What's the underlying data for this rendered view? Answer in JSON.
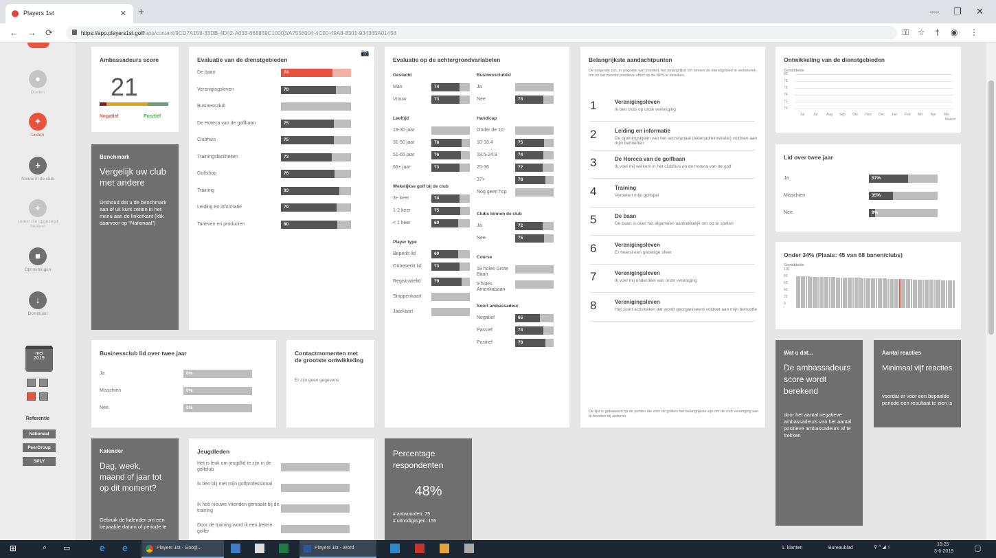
{
  "browser": {
    "tab_title": "Players 1st",
    "url_host": "https://app.players1st.golf",
    "url_path": "/app/content/9CD7A158-33DB-4D42-A033-668859C10003/A7556004-4C00-49A8-8301-934365A01458"
  },
  "sidebar": {
    "items": [
      {
        "label": "Doelen",
        "icon": "user-icon"
      },
      {
        "label": "Leden",
        "icon": "users-icon"
      },
      {
        "label": "Nieuw in de club",
        "icon": "plus-icon"
      },
      {
        "label": "Leden die opgezegd hebben",
        "icon": "minus-icon"
      },
      {
        "label": "Opmerkingen",
        "icon": "comment-icon"
      },
      {
        "label": "Download",
        "icon": "download-icon"
      }
    ],
    "calendar": {
      "month": "mei",
      "year": "2019"
    },
    "reference_title": "Referentie",
    "reference": [
      "Nationaal",
      "PeerGroup",
      "SPLY"
    ]
  },
  "score": {
    "title": "Ambassadeurs score",
    "value": "21",
    "neg": "Negatief",
    "pos": "Positief"
  },
  "benchmark": {
    "head": "Benchmark",
    "title": "Vergelijk uw club met andere",
    "body": "Onthoud dat u de benchmark aan of uit kunt zetten in het menu aan de linkerkant (klik daarvoor op \"Nationaal\")"
  },
  "diensten": {
    "title": "Evaluatie van de dienstgebieden",
    "items": [
      {
        "label": "De baan",
        "value": "74",
        "pct": 0.74,
        "hl": true
      },
      {
        "label": "Verenigingsleven",
        "value": "78",
        "pct": 0.78
      },
      {
        "label": "Businessclub",
        "value": "",
        "pct": 0
      },
      {
        "label": "De Horeca van de golfbaan",
        "value": "75",
        "pct": 0.75
      },
      {
        "label": "Clubhuis",
        "value": "75",
        "pct": 0.75
      },
      {
        "label": "Trainingsfaciliteiten",
        "value": "73",
        "pct": 0.73
      },
      {
        "label": "Golfshop",
        "value": "76",
        "pct": 0.76
      },
      {
        "label": "Training",
        "value": "83",
        "pct": 0.83
      },
      {
        "label": "Leiding en informatie",
        "value": "79",
        "pct": 0.79
      },
      {
        "label": "Tarieven en producten",
        "value": "80",
        "pct": 0.8
      }
    ]
  },
  "achtergrond": {
    "title": "Evaluatie op de achtergrondvariabelen",
    "left": [
      {
        "sub": "Geslacht",
        "rows": [
          {
            "l": "Man",
            "v": "74",
            "p": 0.74
          },
          {
            "l": "Vrouw",
            "v": "73",
            "p": 0.73
          }
        ]
      },
      {
        "sub": "Leeftijd",
        "rows": [
          {
            "l": "19-30 jaar",
            "v": "",
            "p": 0
          },
          {
            "l": "31-50 jaar",
            "v": "78",
            "p": 0.78
          },
          {
            "l": "51-65 jaar",
            "v": "76",
            "p": 0.76
          },
          {
            "l": "66+ jaar",
            "v": "73",
            "p": 0.73
          }
        ]
      },
      {
        "sub": "Wekelijkse golf bij de club",
        "rows": [
          {
            "l": "3+ keer",
            "v": "74",
            "p": 0.74
          },
          {
            "l": "1-2 keer",
            "v": "75",
            "p": 0.75
          },
          {
            "l": "< 1 keer",
            "v": "69",
            "p": 0.69
          }
        ]
      },
      {
        "sub": "Player type",
        "rows": [
          {
            "l": "Beperkt lid",
            "v": "69",
            "p": 0.69
          },
          {
            "l": "Onbeperkt lid",
            "v": "73",
            "p": 0.73
          },
          {
            "l": "Registratielid",
            "v": "79",
            "p": 0.79
          },
          {
            "l": "Strippenkaart",
            "v": "",
            "p": 0
          },
          {
            "l": "Jaarkaart",
            "v": "",
            "p": 0
          }
        ]
      }
    ],
    "right": [
      {
        "sub": "Businessclublid",
        "rows": [
          {
            "l": "Ja",
            "v": "",
            "p": 0
          },
          {
            "l": "Nee",
            "v": "73",
            "p": 0.73
          }
        ]
      },
      {
        "sub": "Handicap",
        "rows": [
          {
            "l": "Onder de 10",
            "v": "",
            "p": 0
          },
          {
            "l": "10-18.4",
            "v": "75",
            "p": 0.75
          },
          {
            "l": "18.5-24.9",
            "v": "74",
            "p": 0.74
          },
          {
            "l": "25-36",
            "v": "72",
            "p": 0.72
          },
          {
            "l": "37+",
            "v": "78",
            "p": 0.78
          },
          {
            "l": "Nog geen hcp",
            "v": "",
            "p": 0
          }
        ]
      },
      {
        "sub": "Clubs binnen de club",
        "rows": [
          {
            "l": "Ja",
            "v": "72",
            "p": 0.72
          },
          {
            "l": "Nee",
            "v": "75",
            "p": 0.75
          }
        ]
      },
      {
        "sub": "Course",
        "rows": [
          {
            "l": "18 holes Grote Baan",
            "v": "",
            "p": 0
          },
          {
            "l": "9 holes Amerikabaan",
            "v": "",
            "p": 0
          }
        ]
      },
      {
        "sub": "Soort ambassadeur",
        "rows": [
          {
            "l": "Negatief",
            "v": "65",
            "p": 0.65
          },
          {
            "l": "Passief",
            "v": "73",
            "p": 0.73
          },
          {
            "l": "Positief",
            "v": "78",
            "p": 0.78
          }
        ]
      }
    ]
  },
  "aandacht": {
    "title": "Belangrijkste aandachtpunten",
    "intro": "De volgende zijn, in volgorde van prioriteit, het belangrijkst om binnen de dienstgebied te verbeteren, om zo het meeste positieve effect op de NPS te bereiken.",
    "items": [
      {
        "n": "1",
        "t": "Verenigingsleven",
        "d": "Ik ben trots op onze vereniging"
      },
      {
        "n": "2",
        "t": "Leiding en informatie",
        "d": "De openingstijden van het secretariaat (ledenadministratie) voldoen aan mijn behoeften"
      },
      {
        "n": "3",
        "t": "De Horeca van de golfbaan",
        "d": "Ik voel mij welkom in het clubhuis en de horeca van de golf"
      },
      {
        "n": "4",
        "t": "Training",
        "d": "Verbetert mijn golfspel"
      },
      {
        "n": "5",
        "t": "De baan",
        "d": "De baan is over het algemeen aantrekkelijk om op te spelen"
      },
      {
        "n": "6",
        "t": "Verenigingsleven",
        "d": "Er heerst een gezellige sfeer"
      },
      {
        "n": "7",
        "t": "Verenigingsleven",
        "d": "Ik voel mij onderdeel van onze vereniging"
      },
      {
        "n": "8",
        "t": "Verenigingsleven",
        "d": "Het soort activiteiten dat wordt georganiseerd voldoet aan mijn behoefte"
      }
    ],
    "footer": "De lijst is gebaseerd op de punten die voor de golfers het belangrijkste zijn om de club vereniging aan te bevelen bij anderen."
  },
  "ontwikkeling": {
    "title": "Ontwikkeling van de dienstgebieden",
    "ylabel": "Gemiddelde",
    "yticks": [
      "80",
      "78",
      "76",
      "74",
      "72",
      "70"
    ],
    "xticks": [
      "Jul",
      "Jul",
      "Aug",
      "Sep",
      "Okt",
      "Nov",
      "Dec",
      "Jan",
      "Feb",
      "Mrt",
      "Apr",
      "Mei"
    ],
    "xlabel": "Maand"
  },
  "lidover": {
    "title": "Lid over twee jaar",
    "items": [
      {
        "l": "Ja",
        "v": "57%",
        "p": 0.57
      },
      {
        "l": "Misschien",
        "v": "35%",
        "p": 0.35
      },
      {
        "l": "Nee",
        "v": "9%",
        "p": 0.09
      }
    ]
  },
  "onder": {
    "title": "Onder 34% (Plaats: 45 van 68 banen/clubs)",
    "ylabel": "Gemiddelde",
    "yticks": [
      "100",
      "80",
      "60",
      "40",
      "20",
      "0"
    ]
  },
  "watdat": {
    "head": "Wat u dat...",
    "title": "De ambassadeurs score wordt berekend",
    "body": "door het aantal negatieve ambassadeurs van het aantal positieve ambassadeurs af te trekken"
  },
  "aantal": {
    "head": "Aantal reacties",
    "title": "Minimaal vijf reacties",
    "body": "voordat er voor een bepaalde periode een resultaat te zien is"
  },
  "business": {
    "title": "Businessclub lid over twee jaar",
    "items": [
      {
        "l": "Ja",
        "v": "0%"
      },
      {
        "l": "Misschien",
        "v": "0%"
      },
      {
        "l": "Nee",
        "v": "0%"
      }
    ]
  },
  "contact": {
    "title": "Contactmomenten met de grootste ontwikkeling",
    "body": "Er zijn geen gegevens"
  },
  "kalender": {
    "head": "Kalender",
    "title": "Dag, week, maand of jaar tot op dit moment?",
    "body": "Gebruik de kalender om een bepaalde datum of periode te"
  },
  "jeugd": {
    "title": "Jeugdleden",
    "items": [
      "Het is leuk om jeugdlid te zijn in de golfclub",
      "Ik ben blij met mijn golfprofessional",
      "Ik heb nieuwe vrienden gemaakt bij de training",
      "Door de training word ik een betere golfer"
    ]
  },
  "percentage": {
    "title": "Percentage respondenten",
    "value": "48%",
    "answers": "# antwoorden: 75",
    "invites": "# uitnodigingen: 155"
  },
  "taskbar": {
    "items": [
      "Players 1st - Googl...",
      "Players 1st - Word"
    ],
    "tray": [
      "1. klanten",
      "Bureaublad"
    ],
    "time": "16:25",
    "date": "3-6-2019"
  },
  "colors": {
    "accent": "#e8533f",
    "dark": "#6f6f6f",
    "bar": "#555555"
  }
}
